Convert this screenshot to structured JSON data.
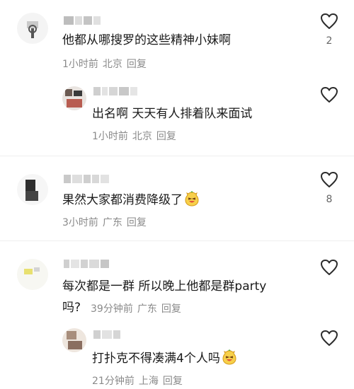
{
  "comments": [
    {
      "text": "他都从哪搜罗的这些精神小妹啊",
      "time": "1小时前",
      "location": "北京",
      "reply_label": "回复",
      "likes": "2",
      "replies": [
        {
          "text": "出名啊 天天有人排着队来面试",
          "time": "1小时前",
          "location": "北京",
          "reply_label": "回复"
        }
      ]
    },
    {
      "text": "果然大家都消费降级了",
      "time": "3小时前",
      "location": "广东",
      "reply_label": "回复",
      "likes": "8",
      "emoji": "laughing-face-emoji"
    },
    {
      "text_line1": "每次都是一群 所以晚上他都是群party",
      "text_line2": "吗?",
      "time": "39分钟前",
      "location": "广东",
      "reply_label": "回复",
      "replies": [
        {
          "text": "打扑克不得凑满4个人吗",
          "time": "21分钟前",
          "location": "上海",
          "reply_label": "回复",
          "emoji": "laughing-face-emoji"
        }
      ]
    }
  ],
  "colors": {
    "meta": "#8a8a8a",
    "text": "#1a1a1a",
    "icon": "#2b2b2b"
  }
}
